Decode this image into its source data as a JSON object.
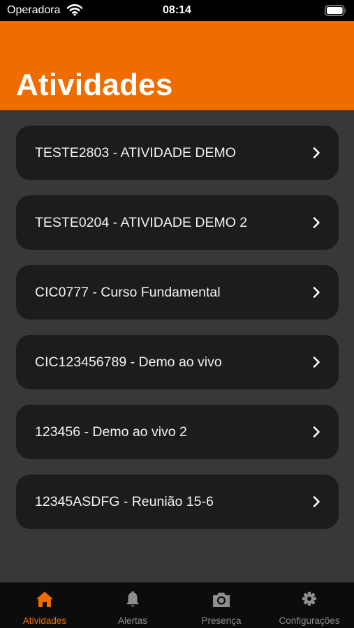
{
  "status_bar": {
    "carrier": "Operadora",
    "time": "08:14",
    "wifi_icon": "wifi-icon",
    "battery_icon": "battery-icon"
  },
  "header": {
    "title": "Atividades",
    "color": "#ef6c00"
  },
  "activities": [
    {
      "label": "TESTE2803 - ATIVIDADE DEMO"
    },
    {
      "label": "TESTE0204 - ATIVIDADE DEMO 2"
    },
    {
      "label": "CIC0777 - Curso Fundamental"
    },
    {
      "label": "CIC123456789 - Demo ao vivo"
    },
    {
      "label": "123456 - Demo ao vivo 2"
    },
    {
      "label": "12345ASDFG - Reunião 15-6"
    }
  ],
  "tab_bar": {
    "active_color": "#ef6c00",
    "inactive_color": "#8e8e8e",
    "tabs": [
      {
        "label": "Atividades",
        "icon": "home-icon",
        "active": true
      },
      {
        "label": "Alertas",
        "icon": "bell-icon",
        "active": false
      },
      {
        "label": "Presença",
        "icon": "camera-icon",
        "active": false
      },
      {
        "label": "Configurações",
        "icon": "gear-icon",
        "active": false
      }
    ]
  }
}
